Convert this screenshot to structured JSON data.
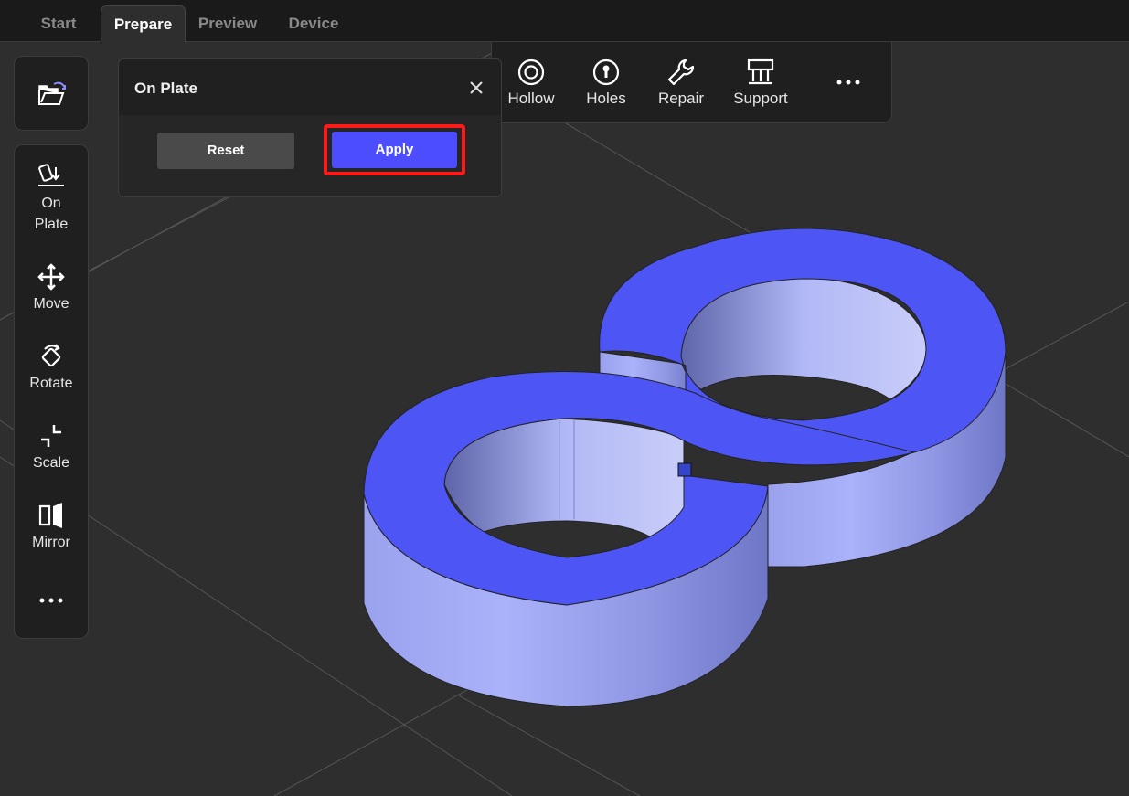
{
  "tabs": [
    {
      "label": "Start",
      "active": false
    },
    {
      "label": "Prepare",
      "active": true
    },
    {
      "label": "Preview",
      "active": false
    },
    {
      "label": "Device",
      "active": false
    }
  ],
  "left_toolbar": {
    "open_button": {
      "icon": "open-folder-icon"
    },
    "tools": [
      {
        "label": "On\nPlate",
        "icon": "on-plate-icon"
      },
      {
        "label": "Move",
        "icon": "move-icon"
      },
      {
        "label": "Rotate",
        "icon": "rotate-icon"
      },
      {
        "label": "Scale",
        "icon": "scale-icon"
      },
      {
        "label": "Mirror",
        "icon": "mirror-icon"
      },
      {
        "label": "",
        "icon": "more-icon"
      }
    ]
  },
  "dialog": {
    "title": "On Plate",
    "reset_label": "Reset",
    "apply_label": "Apply"
  },
  "top_toolbar": {
    "items": [
      {
        "label": "Hollow",
        "icon": "hollow-icon"
      },
      {
        "label": "Holes",
        "icon": "holes-icon"
      },
      {
        "label": "Repair",
        "icon": "wrench-icon"
      },
      {
        "label": "Support",
        "icon": "support-icon"
      }
    ],
    "more_icon": "more-icon"
  },
  "colors": {
    "accent": "#4b4dff",
    "highlight": "#ff1a1a",
    "model_top": "#4d55f5",
    "model_side": "#a6aef7",
    "background": "#2e2e2e"
  }
}
